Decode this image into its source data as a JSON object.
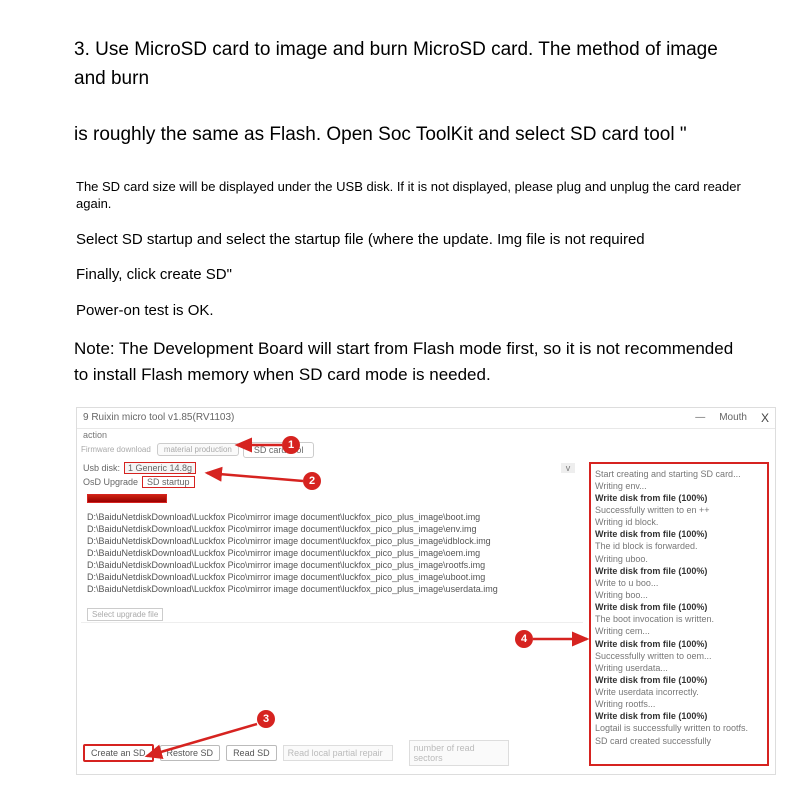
{
  "doc": {
    "line1": "3. Use MicroSD card to image and burn MicroSD card. The method of image and burn",
    "line2": "is roughly the same as Flash. Open Soc ToolKit and select SD card tool \"",
    "sd_hint": "The SD card size will be displayed under the USB disk. If it is not displayed, please plug and unplug the card reader again.",
    "select_startup": "Select SD startup and select the startup file (where the update. Img file is not required",
    "finally": "Finally, click create SD\"",
    "power": "Power-on test is OK.",
    "note": "Note: The Development Board will start from Flash mode first, so it is not recommended to install Flash memory when SD card mode is needed."
  },
  "app": {
    "title": "9 Ruixin micro tool v1.85(RV1103)",
    "min_icon": "—",
    "mouth": "Mouth",
    "close_icon": "X",
    "menu_action": "action",
    "tab_label": "Firmware download",
    "tab_a": "material production",
    "tab_b": "SD card tool",
    "usb_label": "Usb disk:",
    "usb_value": "1 Generic 14.8g",
    "drop_caret": "v",
    "osd_label": "OsD Upgrade",
    "osd_value": "SD startup",
    "files": [
      "D:\\BaiduNetdiskDownload\\Luckfox Pico\\mirror image document\\luckfox_pico_plus_image\\boot.img",
      "D:\\BaiduNetdiskDownload\\Luckfox Pico\\mirror image document\\luckfox_pico_plus_image\\env.img",
      "D:\\BaiduNetdiskDownload\\Luckfox Pico\\mirror image document\\luckfox_pico_plus_image\\idblock.img",
      "D:\\BaiduNetdiskDownload\\Luckfox Pico\\mirror image document\\luckfox_pico_plus_image\\oem.img",
      "D:\\BaiduNetdiskDownload\\Luckfox Pico\\mirror image document\\luckfox_pico_plus_image\\rootfs.img",
      "D:\\BaiduNetdiskDownload\\Luckfox Pico\\mirror image document\\luckfox_pico_plus_image\\uboot.img",
      "D:\\BaiduNetdiskDownload\\Luckfox Pico\\mirror image document\\luckfox_pico_plus_image\\userdata.img"
    ],
    "sel_label": "Select upgrade file",
    "btn_create": "Create an SD",
    "btn_restore": "Restore SD",
    "btn_read": "Read SD",
    "input_local": "Read local partial repair",
    "input_sectors": "number of read sectors",
    "log": [
      {
        "t": "Start creating and starting SD card...",
        "b": false
      },
      {
        "t": "Writing env...",
        "b": false
      },
      {
        "t": "Write disk from file (100%)",
        "b": true
      },
      {
        "t": "Successfully written to en ++",
        "b": false
      },
      {
        "t": "Writing id block.",
        "b": false
      },
      {
        "t": "Write disk from file (100%)",
        "b": true
      },
      {
        "t": "The id block is forwarded.",
        "b": false
      },
      {
        "t": "Writing uboo.",
        "b": false
      },
      {
        "t": "Write disk from file (100%)",
        "b": true
      },
      {
        "t": "Write to u boo...",
        "b": false
      },
      {
        "t": "Writing boo...",
        "b": false
      },
      {
        "t": "Write disk from file (100%)",
        "b": true
      },
      {
        "t": "The boot invocation is written.",
        "b": false
      },
      {
        "t": "Writing cem...",
        "b": false
      },
      {
        "t": "Write disk from file (100%)",
        "b": true
      },
      {
        "t": "Successfully written to oem...",
        "b": false
      },
      {
        "t": "Writing userdata...",
        "b": false
      },
      {
        "t": "Write disk from file (100%)",
        "b": true
      },
      {
        "t": "Write userdata incorrectly.",
        "b": false
      },
      {
        "t": "Writing rootfs...",
        "b": false
      },
      {
        "t": "Write disk from file (100%)",
        "b": true
      },
      {
        "t": "Logtail is successfully written to rootfs.",
        "b": false
      },
      {
        "t": "SD card created successfully",
        "b": false
      }
    ],
    "callouts": {
      "c1": "1",
      "c2": "2",
      "c3": "3",
      "c4": "4"
    }
  }
}
